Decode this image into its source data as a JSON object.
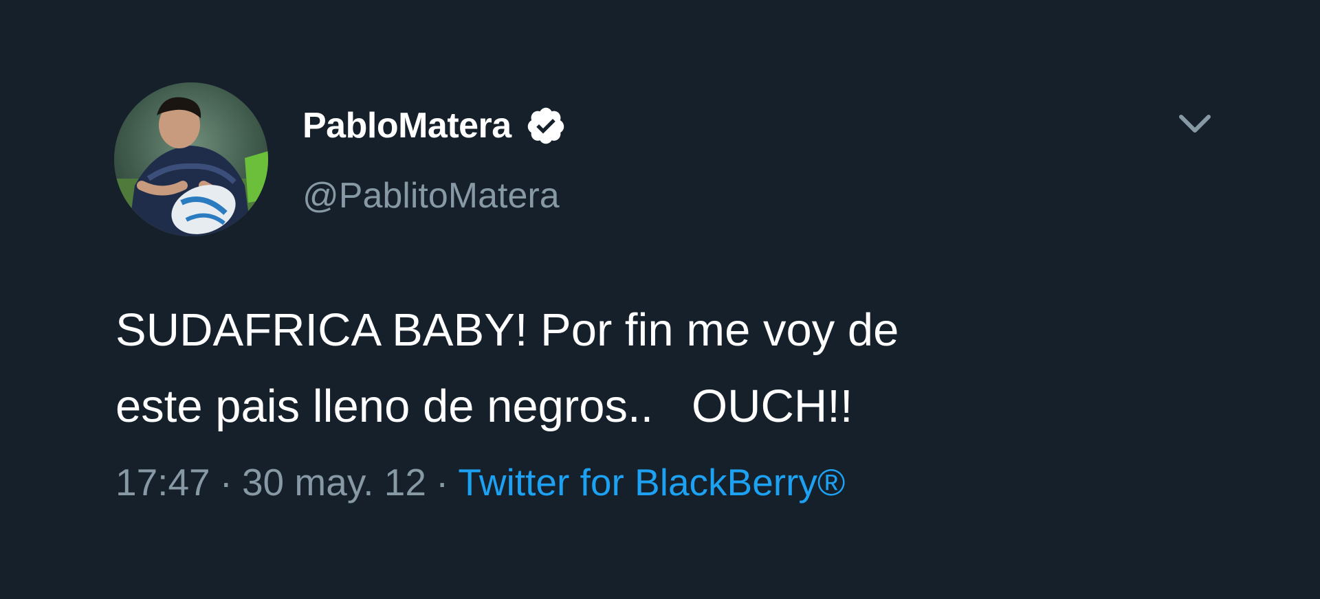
{
  "user": {
    "display_name": "PabloMatera",
    "handle": "@PablitoMatera",
    "verified_icon": "verified-badge-icon",
    "avatar_icon": "profile-photo"
  },
  "menu": {
    "icon": "chevron-down-icon"
  },
  "tweet": {
    "line_1": "SUDAFRICA BABY! Por fin me voy de",
    "line_2": "este pais lleno de negros..   OUCH!!"
  },
  "meta": {
    "time": "17:47",
    "separator": "·",
    "date": "30 may. 12",
    "source": "Twitter for BlackBerry®"
  },
  "colors": {
    "background": "#15202b",
    "primary_text": "#ffffff",
    "secondary_text": "#8899a6",
    "link": "#1da1f2"
  }
}
